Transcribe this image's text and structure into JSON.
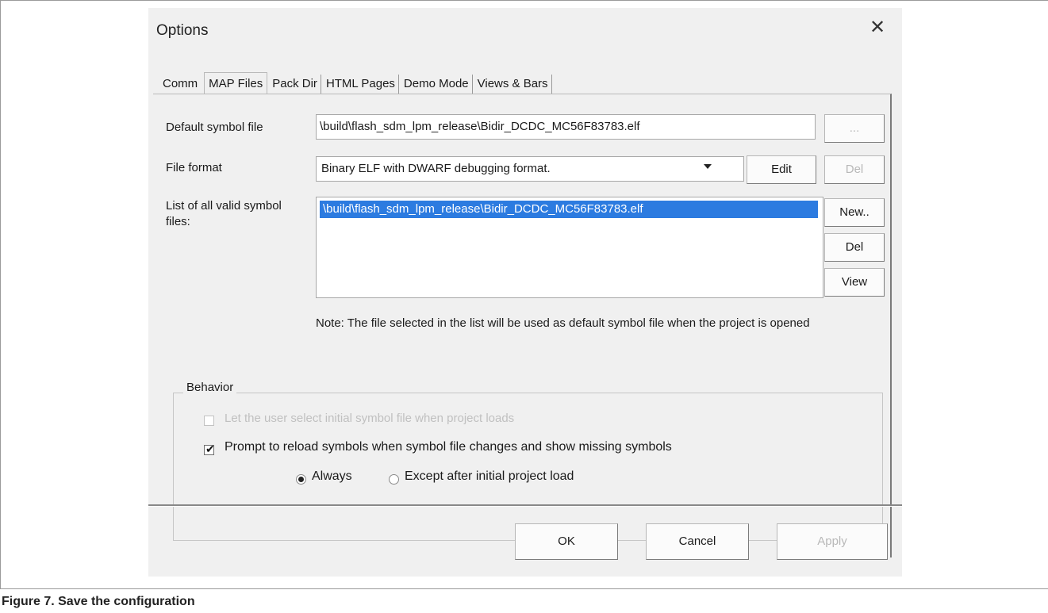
{
  "dialog": {
    "title": "Options",
    "close_icon": "close-icon"
  },
  "tabs": [
    {
      "label": "Comm"
    },
    {
      "label": "MAP Files"
    },
    {
      "label": "Pack Dir"
    },
    {
      "label": "HTML Pages"
    },
    {
      "label": "Demo Mode"
    },
    {
      "label": "Views & Bars"
    }
  ],
  "active_tab": "MAP Files",
  "map_files": {
    "default_symbol_label": "Default symbol file",
    "default_symbol_value": "\\build\\flash_sdm_lpm_release\\Bidir_DCDC_MC56F83783.elf",
    "browse_label": "...",
    "file_format_label": "File format",
    "file_format_value": "Binary ELF with DWARF debugging format.",
    "edit_label": "Edit",
    "del_format_label": "Del",
    "list_label": "List of all valid symbol files:",
    "list_items": [
      "\\build\\flash_sdm_lpm_release\\Bidir_DCDC_MC56F83783.elf"
    ],
    "new_label": "New..",
    "del_label": "Del",
    "view_label": "View",
    "note": "Note: The file selected in the list will be used as default symbol file when the project is opened"
  },
  "behavior": {
    "legend": "Behavior",
    "let_user_select": {
      "label": "Let the user select initial symbol file when project loads",
      "checked": false,
      "enabled": false
    },
    "prompt_reload": {
      "label": "Prompt to reload symbols when symbol file changes and show missing symbols",
      "checked": true,
      "enabled": true
    },
    "radio_always": {
      "label": "Always",
      "selected": true
    },
    "radio_except": {
      "label": "Except after initial project load",
      "selected": false
    }
  },
  "footer": {
    "ok_label": "OK",
    "cancel_label": "Cancel",
    "apply_label": "Apply"
  },
  "caption": "Figure 7.  Save the configuration"
}
